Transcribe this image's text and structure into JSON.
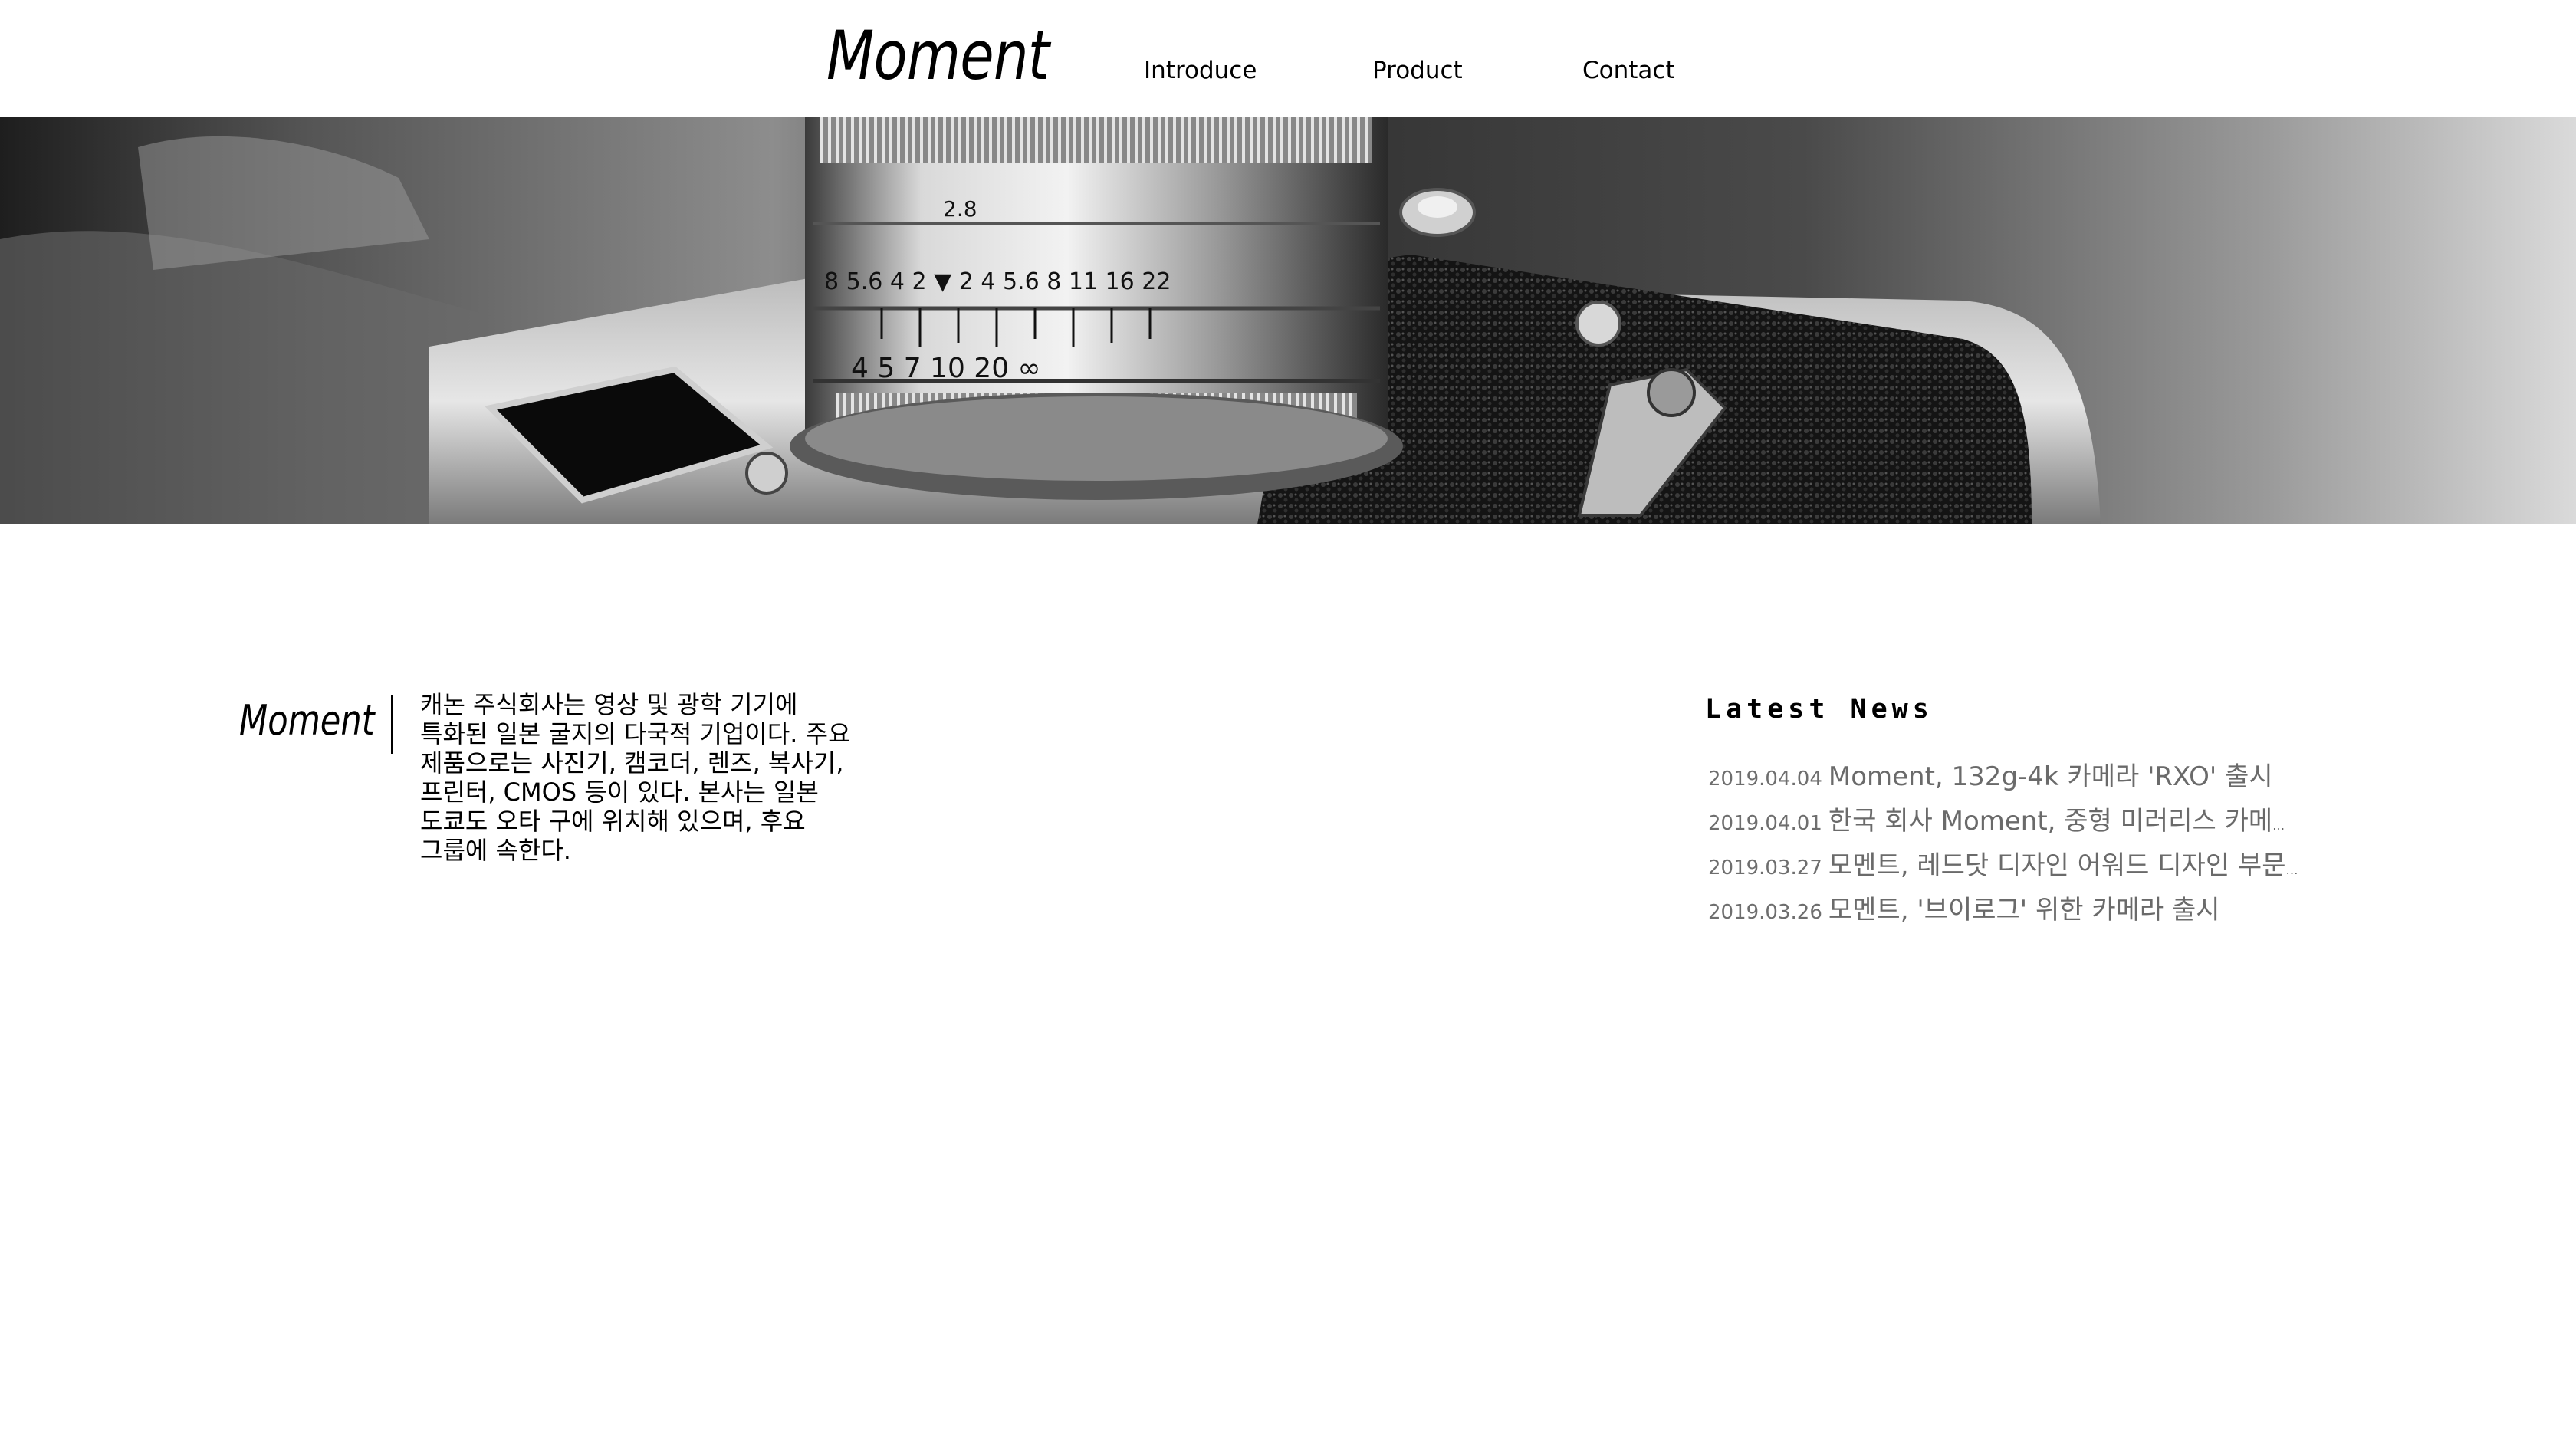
{
  "header": {
    "logo": "Moment",
    "nav": [
      {
        "label": "Introduce"
      },
      {
        "label": "Product"
      },
      {
        "label": "Contact"
      }
    ]
  },
  "hero": {
    "image": "camera-lens-photo",
    "lens_markings": {
      "aperture_row": "2.8",
      "scale_row": "8 5.6 4 2 ▼ 2 4 5.6 8 11 16 22",
      "distance_row": "4 5 7 10 20 ∞"
    }
  },
  "intro": {
    "logo": "Moment",
    "text": "캐논 주식회사는 영상 및 광학 기기에 특화된 일본 굴지의 다국적 기업이다. 주요 제품으로는 사진기, 캠코더, 렌즈, 복사기, 프린터, CMOS 등이 있다. 본사는 일본 도쿄도 오타 구에 위치해 있으며, 후요 그룹에 속한다."
  },
  "news": {
    "title": "Latest News",
    "items": [
      {
        "date": "2019.04.04",
        "title": "Moment, 132g-4k 카메라 'RXO' 출시"
      },
      {
        "date": "2019.04.01",
        "title": "한국 회사 Moment, 중형 미러리스 카메라 ..."
      },
      {
        "date": "2019.03.27",
        "title": "모멘트, 레드닷 디자인 어워드 디자인 부문 ..."
      },
      {
        "date": "2019.03.26",
        "title": "모멘트, '브이로그' 위한 카메라 출시"
      }
    ]
  }
}
